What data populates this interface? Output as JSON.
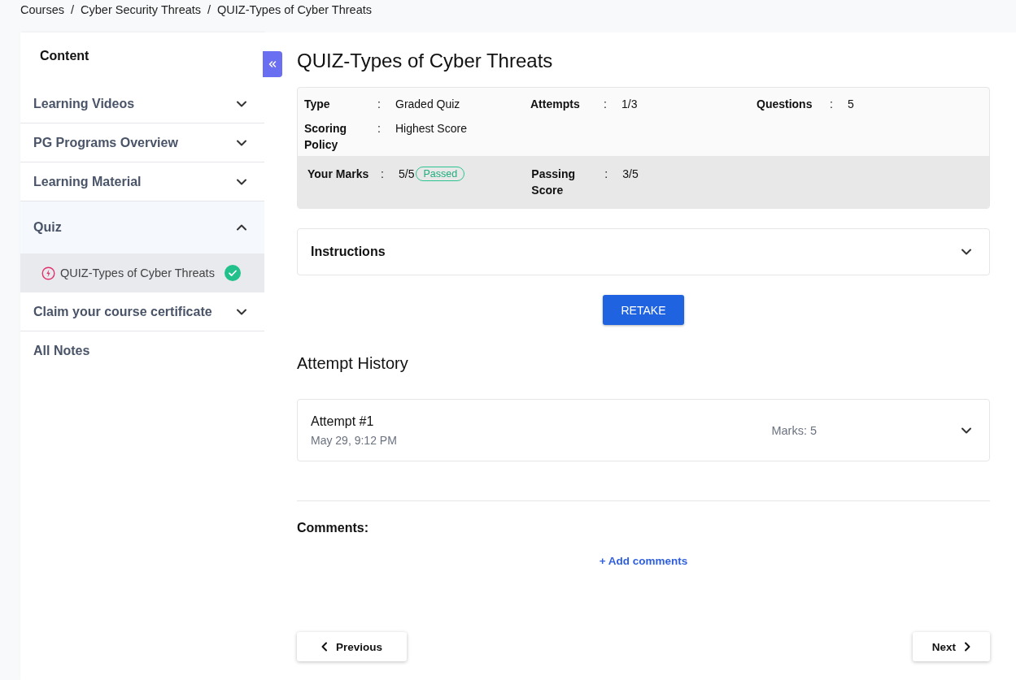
{
  "breadcrumb": [
    {
      "label": "Courses"
    },
    {
      "separator": "/",
      "label": "Cyber Security Threats"
    },
    {
      "separator": "/",
      "label": "QUIZ-Types of Cyber Threats"
    }
  ],
  "sidebar": {
    "title": "Content",
    "items": [
      {
        "label": "Learning Videos",
        "kind": "section",
        "expanded": false
      },
      {
        "label": "PG Programs Overview",
        "kind": "section",
        "expanded": false
      },
      {
        "label": "Learning Material",
        "kind": "section",
        "expanded": false
      },
      {
        "label": "Quiz",
        "kind": "section",
        "expanded": true,
        "children": [
          {
            "label": "QUIZ-Types of Cyber Threats",
            "selected": true,
            "completed": true
          }
        ]
      },
      {
        "label": "Claim your course certificate",
        "kind": "section",
        "expanded": false
      },
      {
        "label": "All Notes",
        "kind": "link"
      }
    ]
  },
  "title": "QUIZ-Types of Cyber Threats",
  "details": [
    {
      "label": "Type",
      "separator": ":",
      "value": "Graded Quiz"
    },
    {
      "label": "Attempts",
      "separator": ":",
      "value": "1/3"
    },
    {
      "label": "Questions",
      "separator": ":",
      "value": "5"
    },
    {
      "label": "Scoring Policy",
      "separator": ":",
      "value": "Highest Score"
    }
  ],
  "results": [
    {
      "label": "Your Marks",
      "separator": ":",
      "value": "5/5",
      "badge": "Passed"
    },
    {
      "label": "Passing Score",
      "separator": ":",
      "value": "3/5"
    }
  ],
  "instructions": {
    "title": "Instructions",
    "expanded": false
  },
  "retake_button": "RETAKE",
  "attempt_history": {
    "title": "Attempt History",
    "attempts": [
      {
        "title": "Attempt #1",
        "date": "May 29, 9:12 PM",
        "marks": "Marks: 5",
        "expanded": false
      }
    ]
  },
  "comments": {
    "title": "Comments:",
    "add": "+ Add comments"
  },
  "nav": {
    "previous": "Previous",
    "next": "Next"
  }
}
